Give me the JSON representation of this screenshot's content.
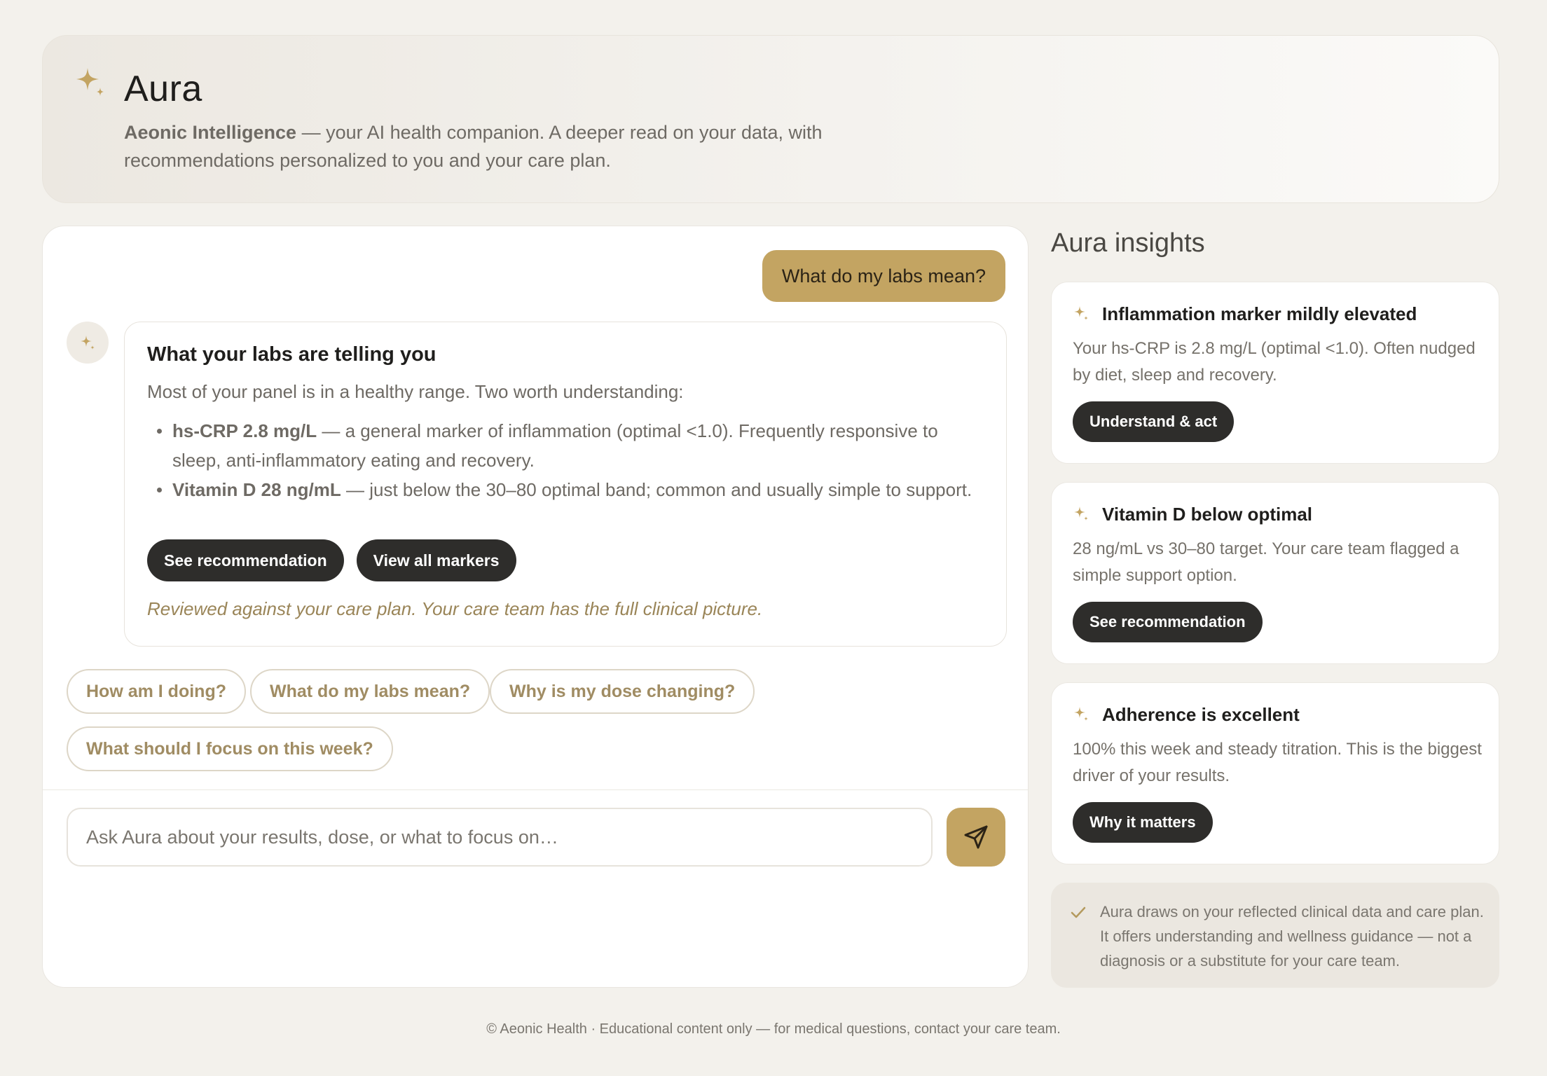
{
  "header": {
    "title": "Aura",
    "brand": "Aeonic Intelligence",
    "description": " — your AI health companion. A deeper read on your data, with recommendations personalized to you and your care plan.",
    "icon": "sparkle-icon"
  },
  "chat": {
    "user_message": "What do my labs mean?",
    "reply": {
      "title": "What your labs are telling you",
      "intro": "Most of your panel is in a healthy range. Two worth understanding:",
      "items": [
        {
          "label": "hs-CRP 2.8 mg/L",
          "text": " — a general marker of inflammation (optimal <1.0). Frequently responsive to sleep, anti-inflammatory eating and recovery."
        },
        {
          "label": "Vitamin D 28 ng/mL",
          "text": " — just below the 30–80 optimal band; common and usually simple to support."
        }
      ],
      "buttons": [
        "See recommendation",
        "View all markers"
      ],
      "note": "Reviewed against your care plan. Your care team has the full clinical picture."
    },
    "suggestions": [
      "How am I doing?",
      "What do my labs mean?",
      "Why is my dose changing?",
      "What should I focus on this week?"
    ],
    "input_placeholder": "Ask Aura about your results, dose, or what to focus on…",
    "send_icon": "send-icon"
  },
  "insights": {
    "title": "Aura insights",
    "cards": [
      {
        "title": "Inflammation marker mildly elevated",
        "text": "Your hs-CRP is 2.8 mg/L (optimal <1.0). Often nudged by diet, sleep and recovery.",
        "button": "Understand & act"
      },
      {
        "title": "Vitamin D below optimal",
        "text": "28 ng/mL vs 30–80 target. Your care team flagged a simple support option.",
        "button": "See recommendation"
      },
      {
        "title": "Adherence is excellent",
        "text": "100% this week and steady titration. This is the biggest driver of your results.",
        "button": "Why it matters"
      }
    ],
    "disclaimer": "Aura draws on your reflected clinical data and care plan. It offers understanding and wellness guidance — not a diagnosis or a substitute for your care team."
  },
  "footer": "© Aeonic Health · Educational content only — for medical questions, contact your care team.",
  "colors": {
    "accent": "#c3a462",
    "dark_button": "#2e2d2b",
    "background": "#f3f1ec"
  }
}
